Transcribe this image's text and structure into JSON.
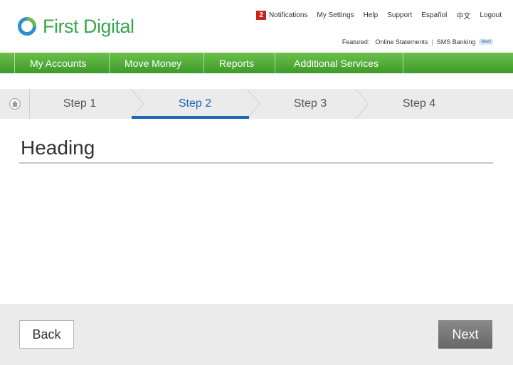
{
  "brand": {
    "name": "First Digital"
  },
  "utility": {
    "notification_count": "2",
    "notifications": "Notifications",
    "settings": "My Settings",
    "help": "Help",
    "support": "Support",
    "spanish": "Español",
    "chinese": "中文",
    "logout": "Logout"
  },
  "featured": {
    "label": "Featured:",
    "online_statements": "Online Statements",
    "separator": "|",
    "sms_banking": "SMS Banking",
    "new_badge": "New!"
  },
  "nav": {
    "items": [
      {
        "label": "My Accounts"
      },
      {
        "label": "Move Money"
      },
      {
        "label": "Reports"
      },
      {
        "label": "Additional Services"
      }
    ]
  },
  "steps": {
    "items": [
      {
        "label": "Step 1"
      },
      {
        "label": "Step 2"
      },
      {
        "label": "Step 3"
      },
      {
        "label": "Step 4"
      }
    ],
    "active_index": 1
  },
  "main": {
    "heading": "Heading"
  },
  "footer": {
    "back_label": "Back",
    "next_label": "Next"
  },
  "colors": {
    "brand_green": "#3aa44d",
    "nav_green": "#4aa832",
    "active_blue": "#1a66b8",
    "notification_red": "#c9231e"
  }
}
